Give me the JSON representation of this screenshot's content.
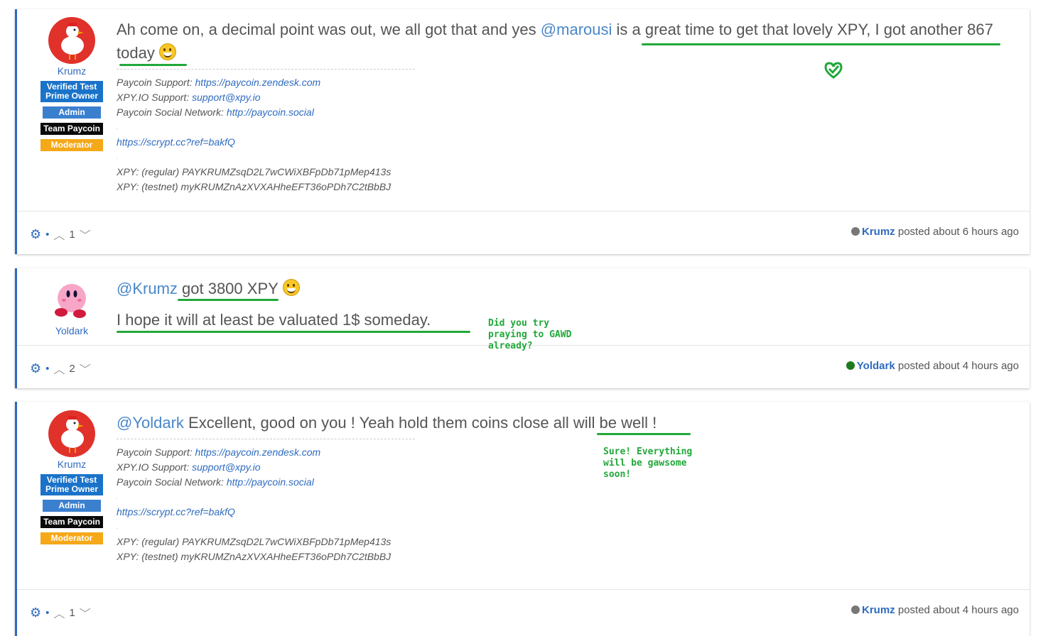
{
  "posts": [
    {
      "author": "Krumz",
      "badges": [
        "Verified Test Prime Owner",
        "Admin",
        "Team Paycoin",
        "Moderator"
      ],
      "message_pre": "Ah come on, a decimal point was out, we all got that and yes ",
      "mention": "@marousi",
      "message_post": " is a great time to get that lovely XPY, I got another 867 today",
      "signature": {
        "support_label": "Paycoin Support: ",
        "support_link": "https://paycoin.zendesk.com",
        "xpyio_label": "XPY.IO Support: ",
        "xpyio_link": "support@xpy.io",
        "social_label": "Paycoin Social Network: ",
        "social_link": "http://paycoin.social",
        "ref_link": "https://scrypt.cc?ref=bakfQ",
        "xpy_regular": "XPY: (regular) PAYKRUMZsqD2L7wCWiXBFpDb71pMep413s",
        "xpy_testnet": "XPY: (testnet) myKRUMZnAzXVXAHheEFT36oPDh7C2tBbBJ"
      },
      "votes": "1",
      "meta_user": "Krumz",
      "meta_text": " posted about 6 hours ago",
      "status_color": "#777777"
    },
    {
      "author": "Yoldark",
      "mention": "@Krumz",
      "line1": " got 3800 XPY",
      "line2": "I hope it will at least be valuated 1$ someday.",
      "votes": "2",
      "meta_user": "Yoldark",
      "meta_text": " posted about 4 hours ago",
      "status_color": "#1e7a1e"
    },
    {
      "author": "Krumz",
      "badges": [
        "Verified Test Prime Owner",
        "Admin",
        "Team Paycoin",
        "Moderator"
      ],
      "mention": "@Yoldark",
      "message_post": " Excellent, good on you ! Yeah hold them coins close all will be well !",
      "signature": {
        "support_label": "Paycoin Support: ",
        "support_link": "https://paycoin.zendesk.com",
        "xpyio_label": "XPY.IO Support: ",
        "xpyio_link": "support@xpy.io",
        "social_label": "Paycoin Social Network: ",
        "social_link": "http://paycoin.social",
        "ref_link": "https://scrypt.cc?ref=bakfQ",
        "xpy_regular": "XPY: (regular) PAYKRUMZsqD2L7wCWiXBFpDb71pMep413s",
        "xpy_testnet": "XPY: (testnet) myKRUMZnAzXVXAHheEFT36oPDh7C2tBbBJ"
      },
      "votes": "1",
      "meta_user": "Krumz",
      "meta_text": " posted about 4 hours ago",
      "status_color": "#777777"
    }
  ],
  "annotations": {
    "note1": "Did you try praying to GAWD already?",
    "note2": "Sure! Everything will be gawsome soon!"
  },
  "icons": {
    "gear": "gear-icon",
    "up": "chevron-up-icon",
    "down": "chevron-down-icon",
    "check": "heart-check-icon"
  },
  "colors": {
    "accent": "#2e6bbf",
    "annotation": "#22a83a"
  }
}
